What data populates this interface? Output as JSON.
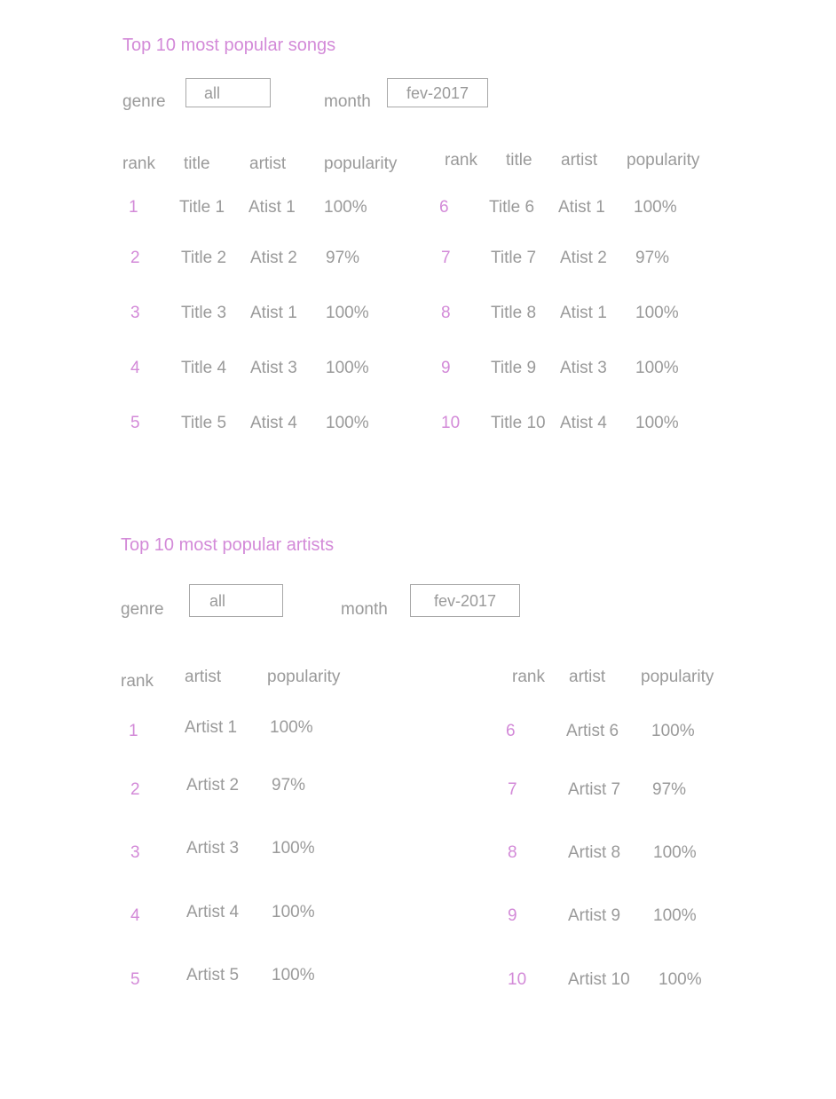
{
  "songs": {
    "title": "Top 10 most popular songs",
    "filters": {
      "genre_label": "genre",
      "genre_value": "all",
      "month_label": "month",
      "month_value": "fev-2017"
    },
    "headers": {
      "rank": "rank",
      "title": "title",
      "artist": "artist",
      "popularity": "popularity"
    },
    "rows": [
      {
        "rank": "1",
        "title": "Title 1",
        "artist": "Atist 1",
        "popularity": "100%"
      },
      {
        "rank": "2",
        "title": "Title 2",
        "artist": "Atist 2",
        "popularity": "97%"
      },
      {
        "rank": "3",
        "title": "Title 3",
        "artist": "Atist 1",
        "popularity": "100%"
      },
      {
        "rank": "4",
        "title": "Title 4",
        "artist": "Atist 3",
        "popularity": "100%"
      },
      {
        "rank": "5",
        "title": "Title 5",
        "artist": "Atist 4",
        "popularity": "100%"
      },
      {
        "rank": "6",
        "title": "Title 6",
        "artist": "Atist 1",
        "popularity": "100%"
      },
      {
        "rank": "7",
        "title": "Title 7",
        "artist": "Atist 2",
        "popularity": "97%"
      },
      {
        "rank": "8",
        "title": "Title 8",
        "artist": "Atist 1",
        "popularity": "100%"
      },
      {
        "rank": "9",
        "title": "Title 9",
        "artist": "Atist 3",
        "popularity": "100%"
      },
      {
        "rank": "10",
        "title": "Title 10",
        "artist": "Atist 4",
        "popularity": "100%"
      }
    ]
  },
  "artists": {
    "title": "Top 10 most popular artists",
    "filters": {
      "genre_label": "genre",
      "genre_value": "all",
      "month_label": "month",
      "month_value": "fev-2017"
    },
    "headers": {
      "rank": "rank",
      "artist": "artist",
      "popularity": "popularity"
    },
    "rows": [
      {
        "rank": "1",
        "artist": "Artist 1",
        "popularity": "100%"
      },
      {
        "rank": "2",
        "artist": "Artist 2",
        "popularity": "97%"
      },
      {
        "rank": "3",
        "artist": "Artist 3",
        "popularity": "100%"
      },
      {
        "rank": "4",
        "artist": "Artist 4",
        "popularity": "100%"
      },
      {
        "rank": "5",
        "artist": "Artist 5",
        "popularity": "100%"
      },
      {
        "rank": "6",
        "artist": "Artist 6",
        "popularity": "100%"
      },
      {
        "rank": "7",
        "artist": "Artist 7",
        "popularity": "97%"
      },
      {
        "rank": "8",
        "artist": "Artist 8",
        "popularity": "100%"
      },
      {
        "rank": "9",
        "artist": "Artist 9",
        "popularity": "100%"
      },
      {
        "rank": "10",
        "artist": "Artist 10",
        "popularity": "100%"
      }
    ]
  },
  "colors": {
    "accent": "#d38ad8",
    "text": "#9a9a9a",
    "border": "#a8a8a8"
  }
}
